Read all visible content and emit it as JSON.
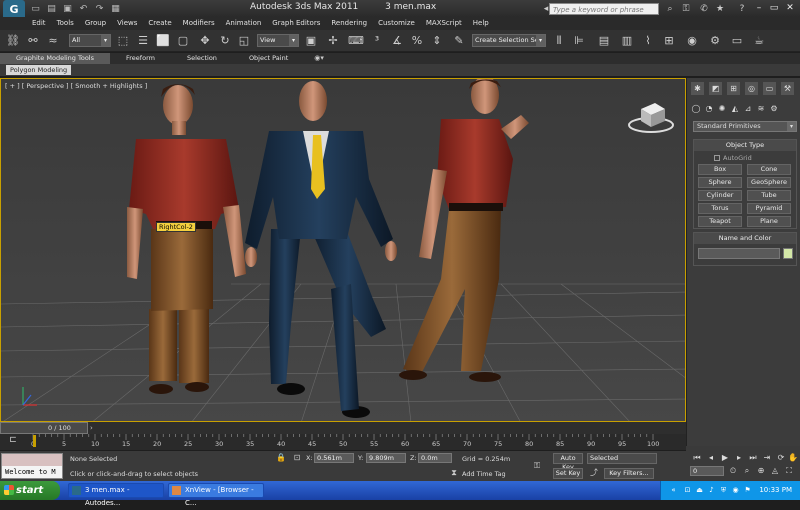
{
  "window": {
    "app_name": "Autodesk 3ds Max  2011",
    "file_name": "3 men.max",
    "search_placeholder": "Type a keyword or phrase"
  },
  "menu": [
    "Edit",
    "Tools",
    "Group",
    "Views",
    "Create",
    "Modifiers",
    "Animation",
    "Graph Editors",
    "Rendering",
    "Customize",
    "MAXScript",
    "Help"
  ],
  "toolbar": {
    "selection_filter": "All",
    "ref_coord": "View",
    "named_selection": "Create Selection Se"
  },
  "ribbon": {
    "tabs": [
      "Graphite Modeling Tools",
      "Freeform",
      "Selection",
      "Object Paint"
    ],
    "active_sub": "Polygon Modeling"
  },
  "viewport": {
    "label": "[ + ] [ Perspective ] [ Smooth + Highlights ]",
    "tooltip": "RightCol-2"
  },
  "command_panel": {
    "category": "Standard Primitives",
    "object_type_title": "Object Type",
    "autogrid": "AutoGrid",
    "objects": [
      "Box",
      "Cone",
      "Sphere",
      "GeoSphere",
      "Cylinder",
      "Tube",
      "Torus",
      "Pyramid",
      "Teapot",
      "Plane"
    ],
    "name_color_title": "Name and Color"
  },
  "timeline": {
    "frame_readout": "0 / 100",
    "ticks": [
      "0",
      "5",
      "10",
      "15",
      "20",
      "25",
      "30",
      "35",
      "40",
      "45",
      "50",
      "55",
      "60",
      "65",
      "70",
      "75",
      "80",
      "85",
      "90",
      "95",
      "100"
    ]
  },
  "status": {
    "maxscript": "Welcome to M",
    "selection": "None Selected",
    "prompt": "Click or click-and-drag to select objects",
    "x_label": "X:",
    "x_value": "0.561m",
    "y_label": "Y:",
    "y_value": "9.809m",
    "z_label": "Z:",
    "z_value": "0.0m",
    "grid": "Grid = 0.254m",
    "add_time_tag": "Add Time Tag",
    "auto_key": "Auto Key",
    "set_key": "Set Key",
    "key_mode": "Selected",
    "key_filters": "Key Filters...",
    "frame": "0"
  },
  "taskbar": {
    "start": "start",
    "tasks": [
      "3 men.max - Autodes...",
      "XnView - [Browser - C..."
    ],
    "clock": "10:33 PM"
  }
}
